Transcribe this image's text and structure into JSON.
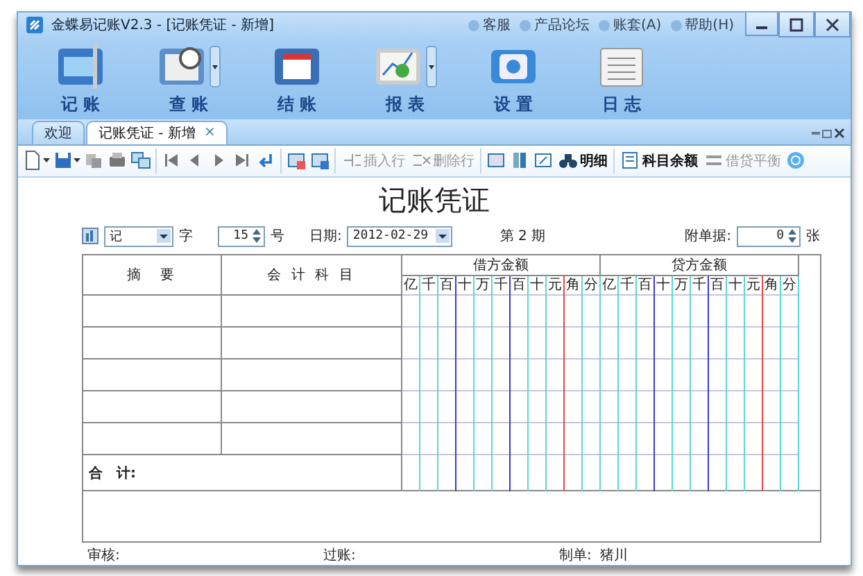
{
  "window": {
    "title": "金蝶易记账V2.3 - [记账凭证 - 新增]",
    "links": [
      {
        "label": "客服"
      },
      {
        "label": "产品论坛"
      },
      {
        "label": "账套(A)"
      },
      {
        "label": "帮助(H)"
      }
    ]
  },
  "ribbon": [
    {
      "label": "记 账",
      "dropdown": false
    },
    {
      "label": "查 账",
      "dropdown": true
    },
    {
      "label": "结 账",
      "dropdown": false
    },
    {
      "label": "报 表",
      "dropdown": true
    },
    {
      "label": "设 置",
      "dropdown": false
    },
    {
      "label": "日 志",
      "dropdown": false
    }
  ],
  "tabs": [
    {
      "label": "欢迎",
      "selected": false
    },
    {
      "label": "记账凭证 - 新增",
      "selected": true,
      "close": "×"
    }
  ],
  "toolbar": [
    {
      "kind": "icon",
      "dropdown": true
    },
    {
      "kind": "icon",
      "dropdown": true
    },
    {
      "kind": "icon",
      "dropdown": false
    },
    {
      "kind": "icon",
      "dropdown": false
    },
    {
      "kind": "icon",
      "dropdown": false
    },
    {
      "kind": "separator"
    },
    {
      "kind": "icon",
      "dropdown": false
    },
    {
      "kind": "icon",
      "dropdown": false
    },
    {
      "kind": "icon",
      "dropdown": false
    },
    {
      "kind": "icon",
      "dropdown": false
    },
    {
      "kind": "icon",
      "dropdown": false
    },
    {
      "kind": "separator"
    },
    {
      "kind": "icon",
      "dropdown": false
    },
    {
      "kind": "icon",
      "dropdown": false
    },
    {
      "kind": "separator"
    },
    {
      "kind": "text",
      "label": "插入行",
      "disabled": true,
      "bold": false
    },
    {
      "kind": "text",
      "label": "删除行",
      "disabled": true,
      "bold": false
    },
    {
      "kind": "separator"
    },
    {
      "kind": "icon",
      "dropdown": false
    },
    {
      "kind": "icon",
      "dropdown": false
    },
    {
      "kind": "icon",
      "dropdown": false
    },
    {
      "kind": "text",
      "label": "明细",
      "disabled": false,
      "bold": true
    },
    {
      "kind": "separator"
    },
    {
      "kind": "text",
      "label": "科目余额",
      "disabled": false,
      "bold": true
    },
    {
      "kind": "text",
      "label": "借贷平衡",
      "disabled": true,
      "bold": false
    },
    {
      "kind": "icon",
      "dropdown": false
    }
  ],
  "voucher": {
    "title": "记账凭证",
    "word": "记",
    "word_label": "字",
    "number": "15",
    "number_label": "号",
    "date_label": "日期:",
    "date": "2012-02-29",
    "period": "第 2 期",
    "attachments_label": "附单据:",
    "attachments": "0",
    "attachments_unit": "张",
    "columns": {
      "summary": "摘　要",
      "account": "会 计 科 目",
      "debit": "借方金额",
      "credit": "贷方金额"
    },
    "debit_units": [
      "亿",
      "千",
      "百",
      "十",
      "万",
      "千",
      "百",
      "十",
      "元",
      "角",
      "分"
    ],
    "credit_units": [
      "亿",
      "千",
      "百",
      "十",
      "万",
      "千",
      "百",
      "十",
      "元",
      "角",
      "分"
    ],
    "total_label": "合　计:",
    "footer": [
      {
        "label": "审核:"
      },
      {
        "label": "过账:"
      },
      {
        "label": "制单:",
        "value": "猪川"
      }
    ]
  }
}
